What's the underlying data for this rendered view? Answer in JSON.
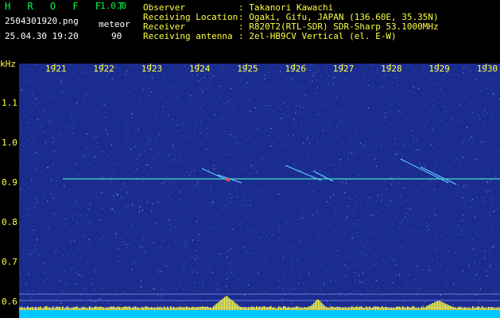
{
  "header": {
    "app_title": "H R O F F T",
    "app_version": "1.0.0",
    "file_name": "2504301920.png",
    "mode": "meteor",
    "datetime": "25.04.30 19:20",
    "count": "90",
    "info": [
      {
        "label": "Observer",
        "value": "Takanori Kawachi"
      },
      {
        "label": "Receiving Location",
        "value": "Ogaki, Gifu, JAPAN (136.60E, 35.35N)"
      },
      {
        "label": "Receiver",
        "value": "R820T2(RTL-SDR) SDR-Sharp 53.1000MHz"
      },
      {
        "label": "Receiving antenna",
        "value": "2el-HB9CV Vertical (el. E-W)"
      }
    ]
  },
  "chart_data": {
    "type": "heatmap",
    "ylabel": "kHz",
    "x_ticks": [
      "1921",
      "1922",
      "1923",
      "1924",
      "1925",
      "1926",
      "1927",
      "1928",
      "1929",
      "1930"
    ],
    "y_ticks": [
      "1.1",
      "1.0",
      "0.9",
      "0.8",
      "0.7",
      "0.6"
    ],
    "carrier_khz": 0.91,
    "colors": {
      "background": "#1b2c8f",
      "noise": "#4a6ad8",
      "carrier": "#40e0d0",
      "baseline": "#00c8ff",
      "axis_text": "#ffff40"
    }
  }
}
